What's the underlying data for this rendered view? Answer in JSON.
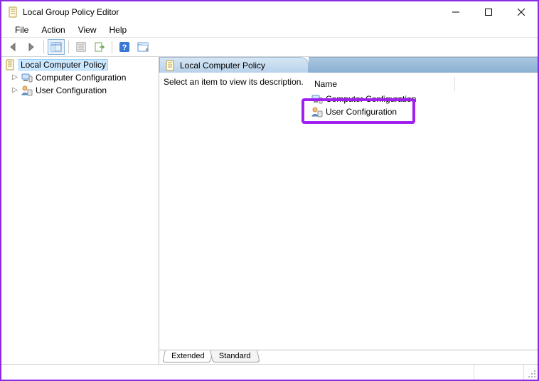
{
  "window": {
    "title": "Local Group Policy Editor"
  },
  "menu": {
    "file": "File",
    "action": "Action",
    "view": "View",
    "help": "Help"
  },
  "tree": {
    "root": "Local Computer Policy",
    "children": [
      {
        "label": "Computer Configuration",
        "icon": "computer"
      },
      {
        "label": "User Configuration",
        "icon": "user"
      }
    ]
  },
  "content": {
    "header": "Local Computer Policy",
    "description_prompt": "Select an item to view its description.",
    "column_name": "Name",
    "items": [
      {
        "label": "Computer Configuration",
        "icon": "computer"
      },
      {
        "label": "User Configuration",
        "icon": "user"
      }
    ]
  },
  "bottom_tabs": {
    "extended": "Extended",
    "standard": "Standard"
  },
  "highlight": {
    "target": "User Configuration",
    "color": "#a020f0"
  }
}
